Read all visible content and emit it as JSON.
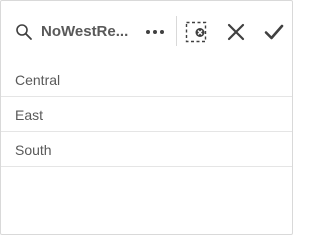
{
  "header": {
    "title": "NoWestRe...",
    "icons": {
      "search": "search-icon",
      "more": "more-icon",
      "clear_selections": "clear-selections-icon",
      "close": "close-icon",
      "confirm": "checkmark-icon"
    }
  },
  "list": {
    "items": [
      {
        "label": "Central"
      },
      {
        "label": "East"
      },
      {
        "label": "South"
      }
    ]
  },
  "colors": {
    "text": "#595959",
    "icon": "#404040",
    "border": "#d9d9d9"
  }
}
